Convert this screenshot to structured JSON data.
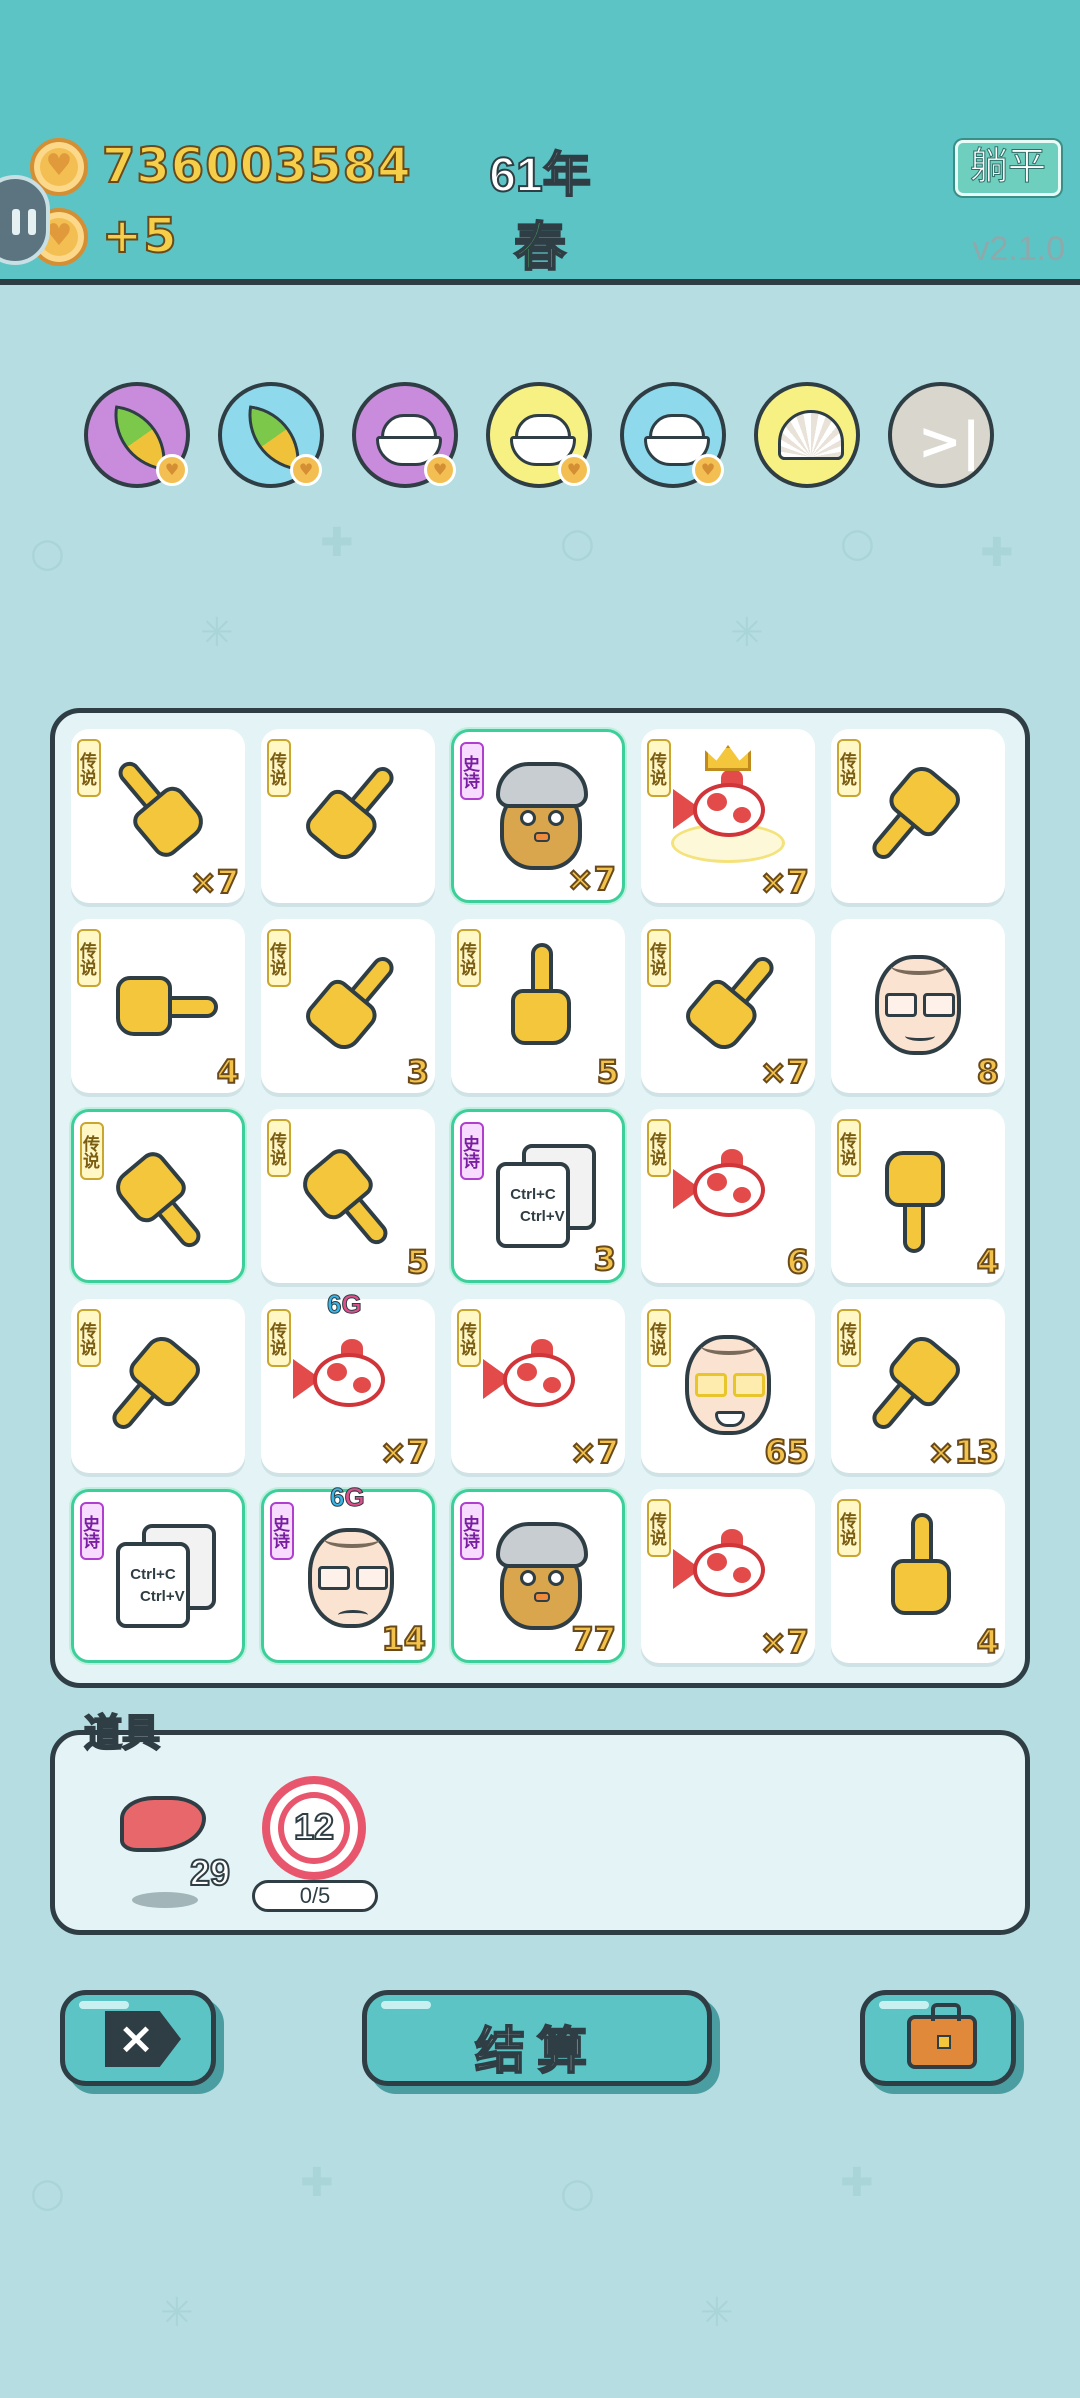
{
  "header": {
    "coins": "736003584",
    "coin_delta": "+5",
    "year": "61年",
    "season": "春",
    "lay_flat_label": "躺平",
    "version": "v2.1.0"
  },
  "slots": [
    {
      "icon": "leaf-icon",
      "color": "#c98bdb"
    },
    {
      "icon": "leaf-icon",
      "color": "#8ed9ec"
    },
    {
      "icon": "rice-bowl-icon",
      "color": "#c98bdb"
    },
    {
      "icon": "rice-bowl-icon",
      "color": "#f7f184"
    },
    {
      "icon": "rice-bowl-icon",
      "color": "#8ed9ec"
    },
    {
      "icon": "seashell-icon",
      "color": "#f7f184"
    },
    {
      "icon": "skip-icon",
      "color": "#d9d6cd"
    }
  ],
  "board": {
    "tags": {
      "legend": "传说",
      "epic": "史诗"
    },
    "cells": [
      {
        "icon": "pointing-hand-icon",
        "rarity": "legend",
        "count": "×7"
      },
      {
        "icon": "pointing-hand-icon",
        "rarity": "legend",
        "count": ""
      },
      {
        "icon": "grey-hair-chick-icon",
        "rarity": "epic",
        "count": "×7"
      },
      {
        "icon": "crowned-koi-fish-icon",
        "rarity": "legend",
        "count": "×7"
      },
      {
        "icon": "pointing-hand-icon",
        "rarity": "legend",
        "count": ""
      },
      {
        "icon": "pointing-hand-icon",
        "rarity": "legend",
        "count": "4"
      },
      {
        "icon": "pointing-hand-icon",
        "rarity": "legend",
        "count": "3"
      },
      {
        "icon": "pointing-hand-icon",
        "rarity": "legend",
        "count": "5"
      },
      {
        "icon": "pointing-hand-icon",
        "rarity": "legend",
        "count": "×7"
      },
      {
        "icon": "old-man-glasses-icon",
        "rarity": "",
        "count": "8"
      },
      {
        "icon": "pointing-hand-icon",
        "rarity": "legend",
        "count": ""
      },
      {
        "icon": "pointing-hand-icon",
        "rarity": "legend",
        "count": "5"
      },
      {
        "icon": "copy-paste-cards-icon",
        "rarity": "epic",
        "count": "3"
      },
      {
        "icon": "koi-fish-icon",
        "rarity": "legend",
        "count": "6"
      },
      {
        "icon": "pointing-hand-icon",
        "rarity": "legend",
        "count": "4"
      },
      {
        "icon": "pointing-hand-icon",
        "rarity": "legend",
        "count": ""
      },
      {
        "icon": "koi-fish-icon",
        "rarity": "legend",
        "count": "×7",
        "badge": "6G"
      },
      {
        "icon": "koi-fish-icon",
        "rarity": "legend",
        "count": "×7"
      },
      {
        "icon": "gold-glasses-bald-man-icon",
        "rarity": "legend",
        "count": "65"
      },
      {
        "icon": "pointing-hand-icon",
        "rarity": "legend",
        "count": "×13"
      },
      {
        "icon": "copy-paste-cards-icon",
        "rarity": "epic",
        "count": ""
      },
      {
        "icon": "sad-bald-man-icon",
        "rarity": "epic",
        "count": "14",
        "badge": "6G"
      },
      {
        "icon": "grey-hair-chick-icon",
        "rarity": "epic",
        "count": "77"
      },
      {
        "icon": "koi-fish-icon",
        "rarity": "legend",
        "count": "×7"
      },
      {
        "icon": "pointing-hand-icon",
        "rarity": "legend",
        "count": "4"
      }
    ],
    "card_text": {
      "copy": "Ctrl+C",
      "paste": "Ctrl+V"
    },
    "badge_parts": {
      "six": "6",
      "g": "G"
    }
  },
  "items": {
    "title": "道具",
    "liver_count": "29",
    "target_number": "12",
    "target_progress": "0/5"
  },
  "buttons": {
    "close_symbol": "×",
    "settle_label": "结算"
  }
}
